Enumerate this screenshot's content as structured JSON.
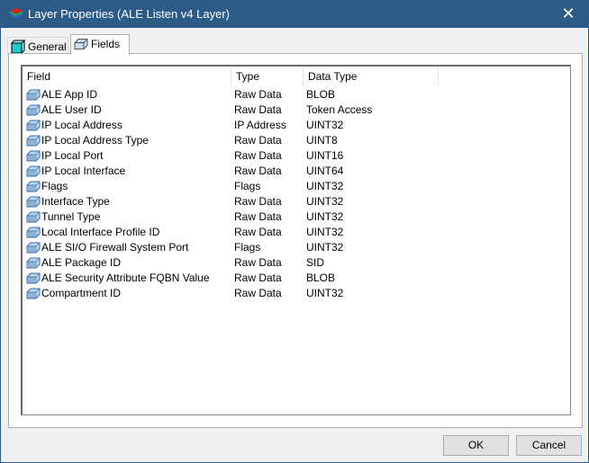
{
  "window": {
    "title": "Layer Properties (ALE Listen v4 Layer)",
    "close": "✕"
  },
  "tabs": [
    {
      "label": "General",
      "active": false
    },
    {
      "label": "Fields",
      "active": true
    }
  ],
  "columns": [
    "Field",
    "Type",
    "Data Type"
  ],
  "rows": [
    [
      "ALE App ID",
      "Raw Data",
      "BLOB"
    ],
    [
      "ALE User ID",
      "Raw Data",
      "Token Access"
    ],
    [
      "IP Local Address",
      "IP Address",
      "UINT32"
    ],
    [
      "IP Local Address Type",
      "Raw Data",
      "UINT8"
    ],
    [
      "IP Local Port",
      "Raw Data",
      "UINT16"
    ],
    [
      "IP Local Interface",
      "Raw Data",
      "UINT64"
    ],
    [
      "Flags",
      "Flags",
      "UINT32"
    ],
    [
      "Interface Type",
      "Raw Data",
      "UINT32"
    ],
    [
      "Tunnel Type",
      "Raw Data",
      "UINT32"
    ],
    [
      "Local Interface Profile ID",
      "Raw Data",
      "UINT32"
    ],
    [
      "ALE SI/O Firewall System Port",
      "Flags",
      "UINT32"
    ],
    [
      "ALE Package ID",
      "Raw Data",
      "SID"
    ],
    [
      "ALE Security Attribute FQBN Value",
      "Raw Data",
      "BLOB"
    ],
    [
      "Compartment ID",
      "Raw Data",
      "UINT32"
    ]
  ],
  "buttons": {
    "ok": "OK",
    "cancel": "Cancel"
  }
}
